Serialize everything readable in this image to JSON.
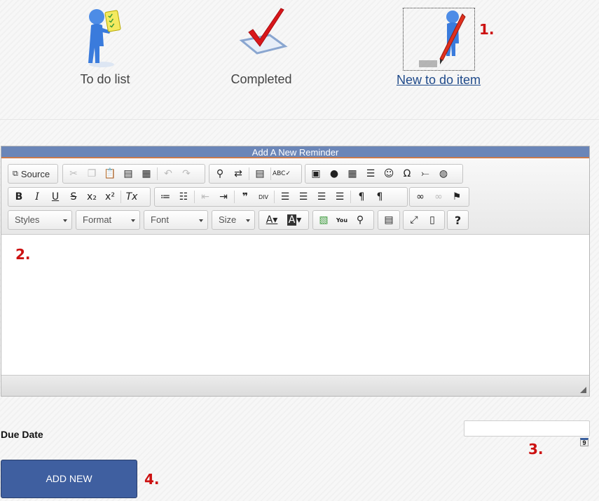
{
  "nav": [
    {
      "label": "To do list",
      "icon": "person-checklist-icon"
    },
    {
      "label": "Completed",
      "icon": "checkmark-icon"
    },
    {
      "label": "New to do item",
      "icon": "person-pencil-icon"
    }
  ],
  "annotations": [
    "1.",
    "2.",
    "3.",
    "4."
  ],
  "panel": {
    "title": "Add A New Reminder"
  },
  "toolbar": {
    "source_label": "Source",
    "styles": "Styles",
    "format": "Format",
    "font": "Font",
    "size": "Size",
    "help": "?"
  },
  "form": {
    "due_label": "Due Date",
    "due_value": "",
    "calendar_day": "9",
    "add_label": "ADD NEW"
  },
  "colors": {
    "panel_header": "#6b86b8",
    "button": "#3f5fa0",
    "annotation": "#cc1111",
    "link": "#1f4a8a"
  }
}
